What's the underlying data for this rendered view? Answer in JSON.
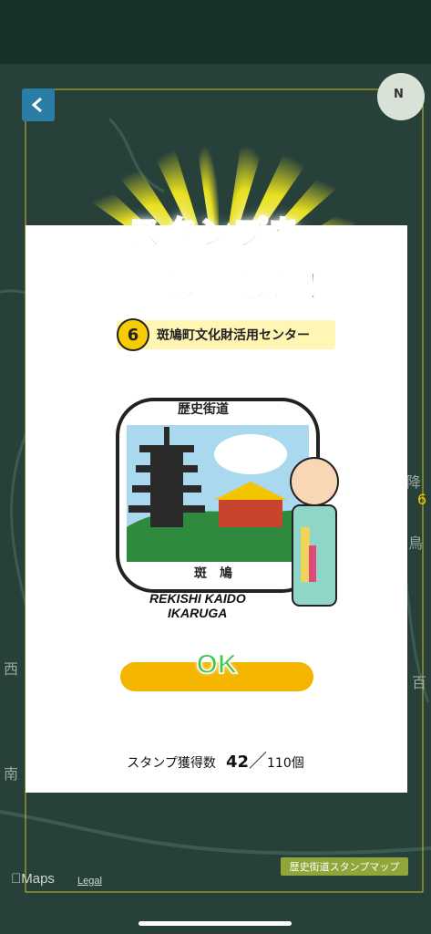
{
  "map": {
    "maps_label": "Maps",
    "legal": "Legal",
    "route_label": "歴史街道スタンプマップ",
    "compass_n": "N",
    "side_texts": [
      "降",
      "6",
      "鳥",
      "南",
      "西",
      "百"
    ]
  },
  "dialog": {
    "headline_line1": "スタンプを",
    "headline_line2": "獲得しました！",
    "location_number": "6",
    "location_name": "斑鳩町文化財活用センター",
    "stamp_title": "歴史街道",
    "stamp_place": "斑鳩",
    "romaji_line1": "REKISHI KAIDO",
    "romaji_line2": "IKARUGA",
    "ok_label": "OK",
    "count_label": "スタンプ獲得数",
    "count_got": "42",
    "count_sep": "／",
    "count_total": "110個"
  },
  "colors": {
    "accent_green": "#3cc43a",
    "button_yellow": "#f4b500",
    "number_badge": "#f7cc00"
  }
}
